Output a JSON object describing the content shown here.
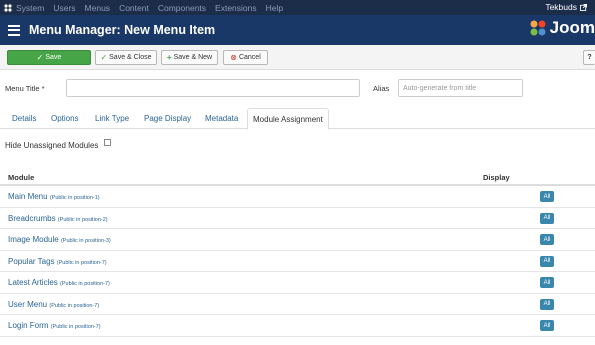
{
  "topbar": {
    "menu": [
      "System",
      "Users",
      "Menus",
      "Content",
      "Components",
      "Extensions",
      "Help"
    ],
    "user": "Tekbuds"
  },
  "header": {
    "title": "Menu Manager: New Menu Item",
    "brand": "Joom"
  },
  "toolbar": {
    "save": "Save",
    "save_close": "Save & Close",
    "save_new": "Save & New",
    "cancel": "Cancel",
    "help": "?"
  },
  "form": {
    "menu_title_label": "Menu Title *",
    "menu_title_value": "",
    "alias_label": "Alias",
    "alias_placeholder": "Auto-generate from title"
  },
  "tabs": [
    "Details",
    "Options",
    "Link Type",
    "Page Display",
    "Metadata",
    "Module Assignment"
  ],
  "active_tab": "Module Assignment",
  "hide_unassigned_label": "Hide Unassigned Modules",
  "table": {
    "headers": {
      "module": "Module",
      "display": "Display"
    },
    "rows": [
      {
        "name": "Main Menu",
        "position": "(Public in position-1)",
        "display": "All"
      },
      {
        "name": "Breadcrumbs",
        "position": "(Public in position-2)",
        "display": "All"
      },
      {
        "name": "Image Module",
        "position": "(Public in position-3)",
        "display": "All"
      },
      {
        "name": "Popular Tags",
        "position": "(Public in position-7)",
        "display": "All"
      },
      {
        "name": "Latest Articles",
        "position": "(Public in position-7)",
        "display": "All"
      },
      {
        "name": "User Menu",
        "position": "(Public in position-7)",
        "display": "All"
      },
      {
        "name": "Login Form",
        "position": "(Public in position-7)",
        "display": "All"
      }
    ]
  },
  "colors": {
    "topbar": "#1c2d4a",
    "header": "#1a3867",
    "save_button": "#46a546",
    "link": "#2a6496",
    "badge": "#3a87ad"
  }
}
